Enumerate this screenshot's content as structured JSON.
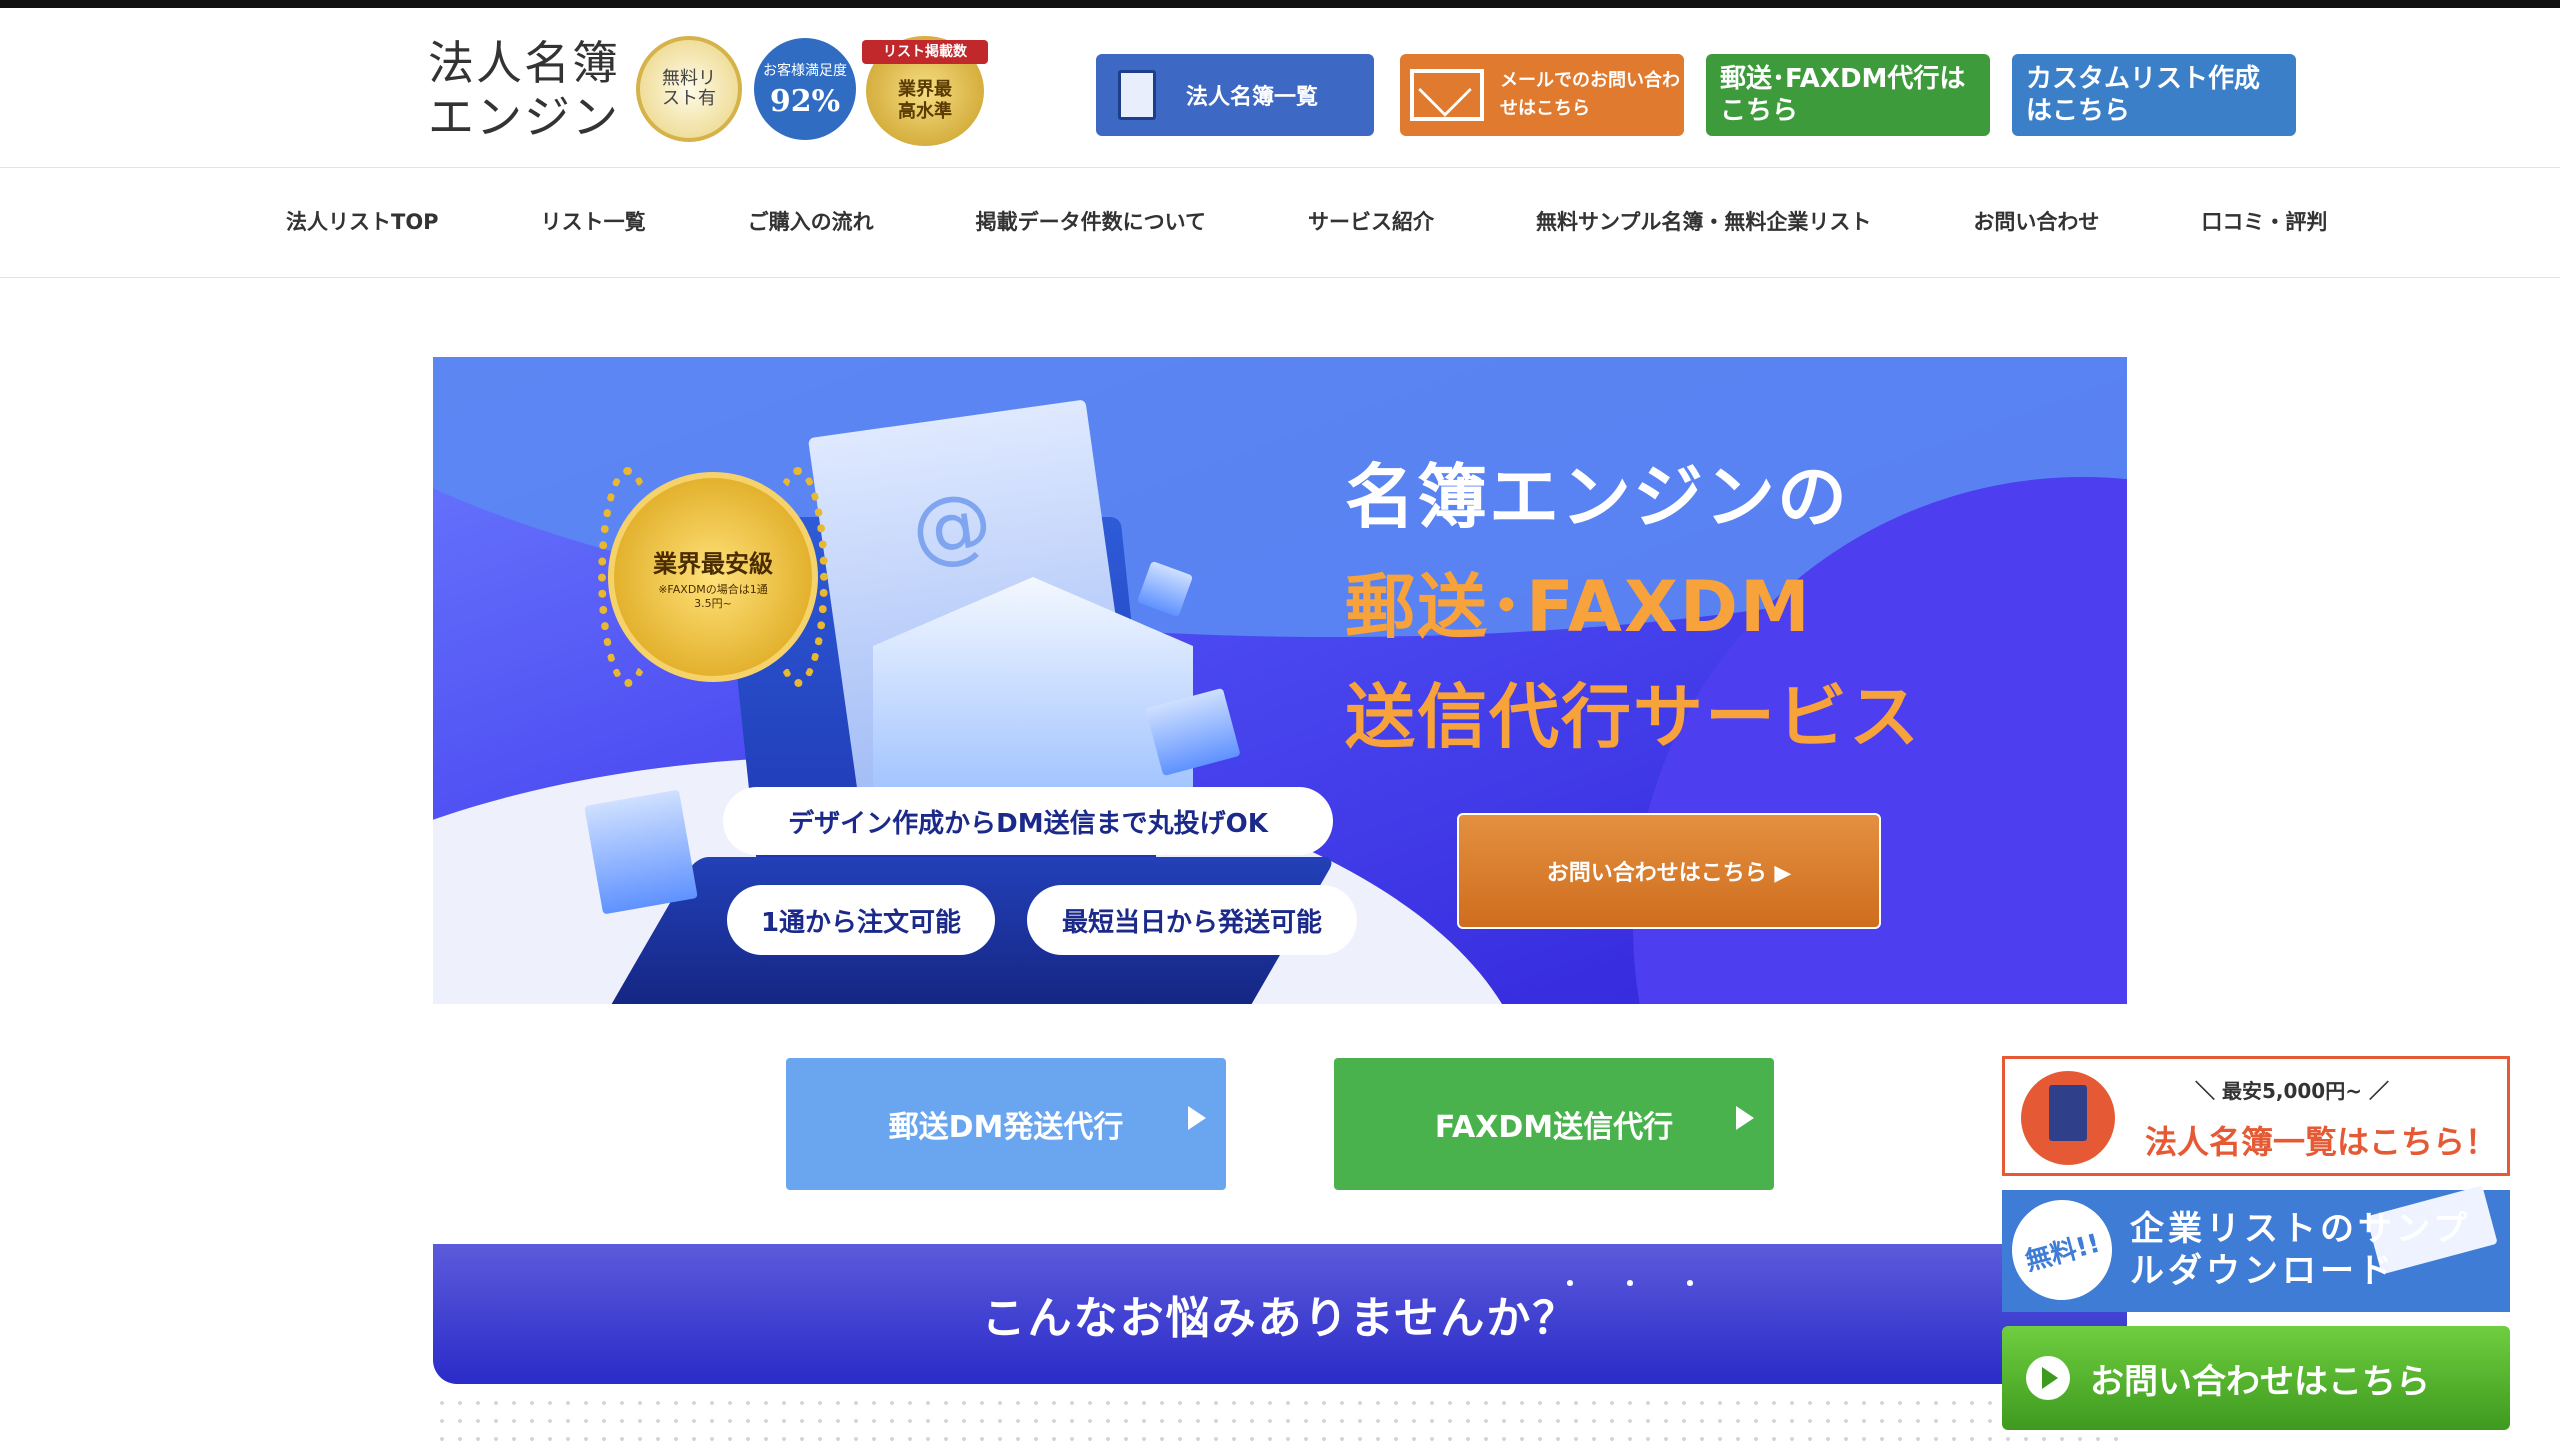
{
  "header": {
    "logo_line1": "法人名簿",
    "logo_line2": "エンジン",
    "badge1": "無料リスト有",
    "badge2_label": "お客様満足度",
    "badge2_value": "92%",
    "badge3_ribbon": "リスト掲載数",
    "badge3_text": "業界最高水準",
    "btn_list": "法人名簿一覧",
    "btn_mail": "メールでのお問い合わせはこちら",
    "btn_fax": "郵送･FAXDM代行はこちら",
    "btn_custom": "カスタムリスト作成はこちら"
  },
  "nav": {
    "items": [
      "法人リストTOP",
      "リスト一覧",
      "ご購入の流れ",
      "掲載データ件数について",
      "サービス紹介",
      "無料サンプル名簿・無料企業リスト",
      "お問い合わせ",
      "口コミ・評判"
    ]
  },
  "hero": {
    "medal_title": "業界最安級",
    "medal_sub": "※FAXDMの場合は1通3.5円~",
    "title1": "名簿エンジンの",
    "title2": "郵送･FAXDM",
    "title3": "送信代行サービス",
    "pill1": "デザイン作成からDM送信まで丸投げOK",
    "pill2": "1通から注文可能",
    "pill3": "最短当日から発送可能",
    "cta": "お問い合わせはこちら ▶"
  },
  "services": {
    "post": "郵送DM発送代行",
    "fax": "FAXDM送信代行"
  },
  "worry": {
    "title": "こんなお悩みありませんか？",
    "dots": "・・・"
  },
  "sidebar": {
    "list_small": "＼ 最安5,000円~ ／",
    "list_big": "法人名簿一覧はこちら！",
    "sample_badge": "無料!!",
    "sample_text": "企業リストのサンプルダウンロード",
    "contact": "お問い合わせはこちら"
  },
  "colors": {
    "hero_blue": "#4a48f0",
    "accent_orange": "#e07a2e",
    "accent_green": "#3e9b3c",
    "accent_blue": "#3b7fc9"
  }
}
